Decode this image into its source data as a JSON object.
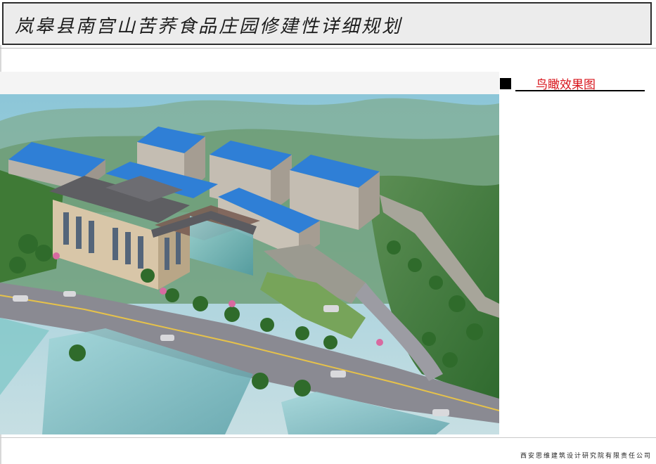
{
  "header": {
    "title": "岚皋县南宫山苦荞食品庄园修建性详细规划"
  },
  "section": {
    "label": "鸟瞰效果图"
  },
  "footer": {
    "company": "西安思维建筑设计研究院有限责任公司"
  },
  "colors": {
    "title_text": "#1c1c1c",
    "section_label": "#d8141b",
    "roof_blue": "#2f7fd6",
    "road": "#8a8a92",
    "hill_green": "#3f7a36"
  }
}
